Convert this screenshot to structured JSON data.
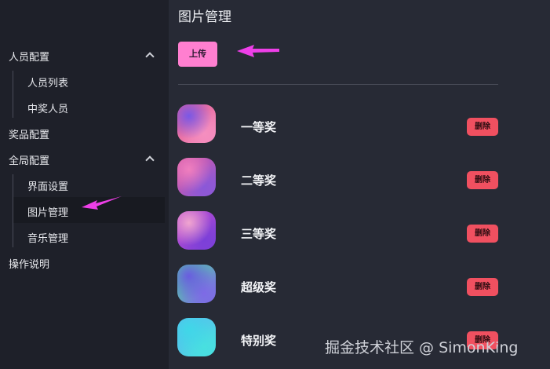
{
  "sidebar": {
    "groups": [
      {
        "label": "人员配置",
        "items": [
          "人员列表",
          "中奖人员"
        ]
      },
      {
        "label": "奖品配置"
      },
      {
        "label": "全局配置",
        "items": [
          "界面设置",
          "图片管理",
          "音乐管理"
        ]
      },
      {
        "label": "操作说明"
      }
    ],
    "active_item": "图片管理"
  },
  "main": {
    "title": "图片管理",
    "upload_label": "上传",
    "delete_label": "删除",
    "prizes": [
      {
        "name": "一等奖",
        "colors": [
          "#7a58e6",
          "#e0588e",
          "#f58fc0"
        ]
      },
      {
        "name": "二等奖",
        "colors": [
          "#f07fbf",
          "#d85aa4",
          "#8a58d8"
        ]
      },
      {
        "name": "三等奖",
        "colors": [
          "#f0a5d0",
          "#c24fd0",
          "#7b3fd8"
        ]
      },
      {
        "name": "超级奖",
        "colors": [
          "#6a5ce0",
          "#4ed3a0",
          "#7e6ae6"
        ]
      },
      {
        "name": "特别奖",
        "colors": [
          "#3fd8e8",
          "#5ab8f0",
          "#48e0e0"
        ]
      }
    ]
  },
  "watermark": "掘金技术社区 @ SimonKing",
  "colors": {
    "accent_pink": "#ff7fd0",
    "delete_red": "#f05060",
    "arrow": "#ee3fe8"
  }
}
